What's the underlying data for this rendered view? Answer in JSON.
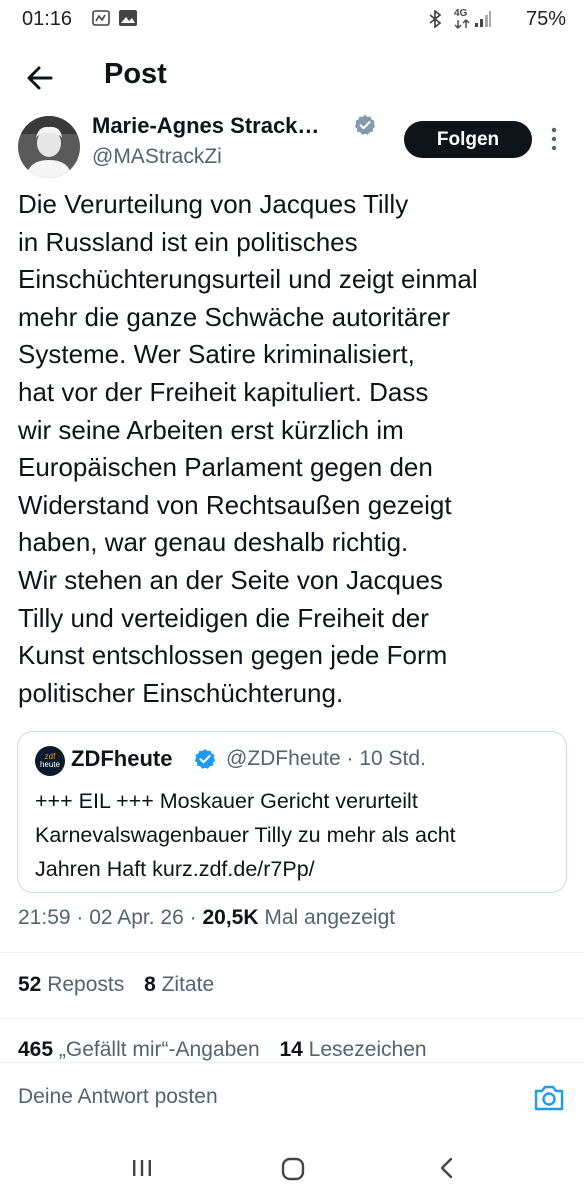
{
  "status_bar": {
    "time": "01:16",
    "network": "4G",
    "battery": "75%",
    "icons": [
      "notification-icon",
      "gallery-icon",
      "bluetooth-icon",
      "network-icon",
      "signal-icon"
    ]
  },
  "header": {
    "title": "Post",
    "back_icon": "arrow-left-icon"
  },
  "author": {
    "name": "Marie-Agnes Strack…",
    "handle": "@MAStrackZi",
    "verified": true,
    "follow_label": "Folgen"
  },
  "tweet": {
    "lines": [
      "Die Verurteilung von Jacques Tilly",
      "in Russland ist ein politisches",
      "Einschüchterungsurteil und zeigt einmal",
      "mehr die ganze Schwäche autoritärer",
      "Systeme. Wer Satire kriminalisiert,",
      "hat vor der Freiheit kapituliert. Dass",
      "wir seine Arbeiten erst kürzlich im",
      "Europäischen Parlament gegen den",
      "Widerstand von Rechtsaußen gezeigt",
      "haben, war genau deshalb richtig.",
      "Wir stehen an der Seite von Jacques",
      "Tilly und verteidigen die Freiheit der",
      "Kunst entschlossen gegen jede Form",
      "politischer Einschüchterung."
    ]
  },
  "quote": {
    "avatar_text_top": "zdf",
    "avatar_text_bottom": "heute",
    "name": "ZDFheute",
    "meta": "@ZDFheute · 10 Std.",
    "lines": [
      "+++ EIL +++ Moskauer Gericht verurteilt",
      "Karnevalswagenbauer Tilly zu mehr als acht",
      "Jahren Haft kurz.zdf.de/r7Pp/"
    ]
  },
  "meta": {
    "time": "21:59 · 02 Apr. 26 · ",
    "views": "20,5K",
    "views_label": " Mal angezeigt"
  },
  "stats": {
    "reposts_count": "52",
    "reposts_label": " Reposts",
    "quotes_count": "8",
    "quotes_label": " Zitate",
    "likes_count": "465",
    "likes_label": " „Gefällt mir“-Angaben",
    "bookmarks_count": "14",
    "bookmarks_label": " Lesezeichen"
  },
  "reply": {
    "placeholder": "Deine Antwort posten"
  },
  "colors": {
    "accent": "#1d9bf0",
    "text": "#0f1419",
    "secondary": "#536471",
    "border": "#cfd9de"
  }
}
